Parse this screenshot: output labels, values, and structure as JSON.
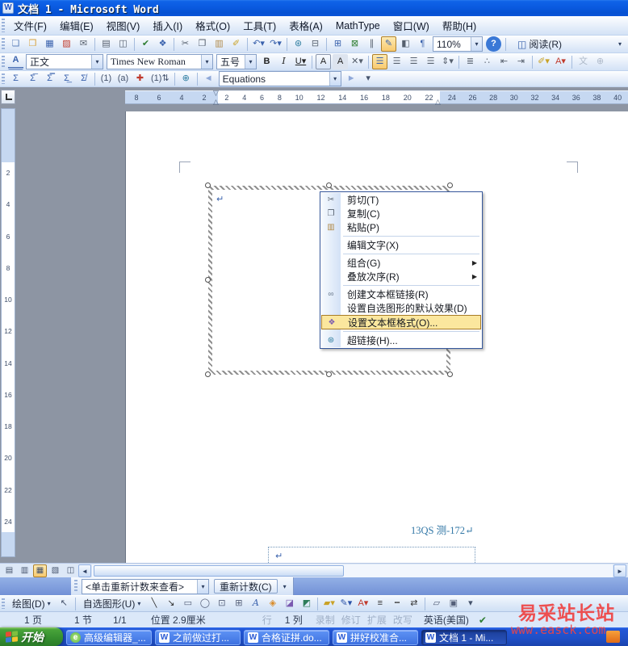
{
  "title_bar": {
    "title": "文档 1 - Microsoft Word",
    "app_icon_glyph": "W"
  },
  "menu_bar": [
    "文件(F)",
    "编辑(E)",
    "视图(V)",
    "插入(I)",
    "格式(O)",
    "工具(T)",
    "表格(A)",
    "MathType",
    "窗口(W)",
    "帮助(H)"
  ],
  "standard_toolbar": {
    "icons": [
      {
        "g": "❏",
        "n": "new-document-icon",
        "c": "#5b7fb9"
      },
      {
        "g": "❒",
        "n": "open-icon",
        "c": "#d8a23c"
      },
      {
        "g": "▦",
        "n": "save-icon",
        "c": "#3a62ad"
      },
      {
        "g": "▨",
        "n": "permission-icon",
        "c": "#c0392b"
      },
      {
        "g": "✉",
        "n": "email-icon",
        "c": "#56606e"
      },
      {
        "type": "s"
      },
      {
        "g": "▤",
        "n": "print-icon",
        "c": "#56606e"
      },
      {
        "g": "◫",
        "n": "print-preview-icon",
        "c": "#56606e"
      },
      {
        "type": "s"
      },
      {
        "g": "✔",
        "n": "spelling-icon",
        "c": "#2e7d32"
      },
      {
        "g": "❖",
        "n": "research-icon",
        "c": "#3a62ad"
      },
      {
        "type": "s"
      },
      {
        "g": "✂",
        "n": "cut-toolbar-icon",
        "c": "#56606e"
      },
      {
        "g": "❐",
        "n": "copy-toolbar-icon",
        "c": "#56606e"
      },
      {
        "g": "▥",
        "n": "paste-toolbar-icon",
        "c": "#b08a4a"
      },
      {
        "g": "✐",
        "n": "format-painter-icon",
        "c": "#c9a227"
      },
      {
        "type": "s"
      },
      {
        "g": "↶▾",
        "n": "undo-button",
        "c": "#3a62ad",
        "cls": "wide"
      },
      {
        "g": "↷▾",
        "n": "redo-button",
        "c": "#3a62ad",
        "cls": "wide"
      },
      {
        "type": "s"
      },
      {
        "g": "⊛",
        "n": "insert-hyperlink-icon",
        "c": "#2e7da0"
      },
      {
        "g": "⊟",
        "n": "tables-borders-icon",
        "c": "#56606e"
      },
      {
        "type": "s"
      },
      {
        "g": "⊞",
        "n": "insert-table-icon",
        "c": "#3a62ad"
      },
      {
        "g": "⊠",
        "n": "insert-excel-icon",
        "c": "#2e7d32"
      },
      {
        "g": "∥",
        "n": "columns-icon",
        "c": "#56606e"
      },
      {
        "g": "✎",
        "n": "drawing-toggle-icon",
        "c": "#3a62ad",
        "cls": "hl"
      },
      {
        "g": "◧",
        "n": "document-map-icon",
        "c": "#56606e"
      },
      {
        "g": "¶",
        "n": "show-hide-marks-icon",
        "c": "#3a62ad"
      }
    ],
    "zoom_value": "110%",
    "help_glyph": "?",
    "read_icon": "◫",
    "read_label": "阅读(R)",
    "overflow_glyph": "▾"
  },
  "formatting_toolbar": {
    "pane_icon": [
      {
        "g": "A",
        "n": "styles-pane-icon",
        "c": "#3a62ad",
        "cls": "stylespane"
      }
    ],
    "style_value": "正文",
    "font_value": "Times New Roman",
    "size_value": "五号",
    "icons": [
      {
        "g": "B",
        "n": "bold-button",
        "c": "#222222",
        "cls": "b"
      },
      {
        "g": "I",
        "n": "italic-button",
        "c": "#222222",
        "cls": "i"
      },
      {
        "g": "U▾",
        "n": "underline-button",
        "c": "#222222",
        "cls": "u wide"
      },
      {
        "type": "s"
      },
      {
        "g": "A",
        "n": "char-border-icon",
        "c": "#222222",
        "cls": "boxed"
      },
      {
        "g": "A",
        "n": "char-shading-icon",
        "c": "#222222",
        "cls": "shaded"
      },
      {
        "g": "✕▾",
        "n": "char-scale-icon",
        "c": "#56606e",
        "cls": "wide"
      },
      {
        "type": "s"
      },
      {
        "g": "☰",
        "n": "align-justify-button",
        "c": "#3a62ad",
        "cls": "hl"
      },
      {
        "g": "☰",
        "n": "align-center-button",
        "c": "#56606e"
      },
      {
        "g": "☰",
        "n": "align-right-button",
        "c": "#56606e"
      },
      {
        "g": "☰",
        "n": "align-distribute-button",
        "c": "#56606e"
      },
      {
        "g": "⇕▾",
        "n": "line-spacing-button",
        "c": "#56606e",
        "cls": "wide"
      },
      {
        "type": "s"
      },
      {
        "g": "≣",
        "n": "numbering-icon",
        "c": "#56606e"
      },
      {
        "g": "∴",
        "n": "bullets-icon",
        "c": "#56606e"
      },
      {
        "g": "⇤",
        "n": "decrease-indent-icon",
        "c": "#56606e"
      },
      {
        "g": "⇥",
        "n": "increase-indent-icon",
        "c": "#56606e"
      },
      {
        "type": "s"
      },
      {
        "g": "✐▾",
        "n": "highlight-color-button",
        "c": "#c9a227",
        "cls": "wide"
      },
      {
        "g": "A▾",
        "n": "font-color-button",
        "c": "#c0392b",
        "cls": "wide"
      },
      {
        "type": "s"
      },
      {
        "g": "文",
        "n": "pinyin-guide-icon",
        "cls": "grayed"
      },
      {
        "g": "⊕",
        "n": "enclose-characters-icon",
        "cls": "grayed"
      }
    ]
  },
  "math_toolbar": {
    "icons": [
      {
        "g": "Σ",
        "n": "mt-inline-equation-icon",
        "c": "#3a62ad"
      },
      {
        "g": "Σ̅",
        "n": "mt-display-equation-icon",
        "c": "#3a62ad"
      },
      {
        "g": "Σ̿",
        "n": "mt-right-numbered-equation-icon",
        "c": "#3a62ad"
      },
      {
        "g": "Σ̲",
        "n": "mt-left-numbered-equation-icon",
        "c": "#3a62ad"
      },
      {
        "g": "Σ̸",
        "n": "mt-convert-equations-icon",
        "c": "#3a62ad"
      },
      {
        "type": "s"
      },
      {
        "g": "(1)",
        "n": "mt-insert-number-icon",
        "c": "#44526b",
        "cls": "wide"
      },
      {
        "g": "(a)",
        "n": "mt-insert-reference-icon",
        "c": "#44526b",
        "cls": "wide"
      },
      {
        "g": "✚",
        "n": "mt-chapter-break-icon",
        "c": "#c0392b"
      },
      {
        "g": "(1)⇅",
        "n": "mt-update-numbers-icon",
        "c": "#44526b",
        "cls": "wide"
      },
      {
        "type": "s"
      },
      {
        "g": "⊕",
        "n": "mt-export-web-icon",
        "c": "#2e7da0"
      },
      {
        "type": "s"
      },
      {
        "g": "◄",
        "n": "mt-prev-equation-icon",
        "c": "#8fa8d8"
      }
    ],
    "combo_value": "Equations",
    "icons_after": [
      {
        "g": "►",
        "n": "mt-next-equation-icon",
        "c": "#8fa8d8"
      },
      {
        "g": "▾",
        "n": "toolbar-options-icon",
        "c": "#44526b"
      }
    ]
  },
  "ruler": {
    "left_numbers": [
      "8",
      "6",
      "4",
      "2"
    ],
    "center_numbers": [
      "2",
      "4",
      "6",
      "8",
      "10",
      "12",
      "14",
      "16",
      "18",
      "20",
      "22"
    ],
    "right_numbers": [
      "24",
      "26",
      "28",
      "30",
      "32",
      "34",
      "36",
      "38",
      "40"
    ],
    "first_line_indent_glyph": "▽",
    "hanging_indent_glyph": "△",
    "right_indent_glyph": "△"
  },
  "vruler_numbers": [
    "2",
    "4",
    "6",
    "8",
    "10",
    "12",
    "14",
    "16",
    "18",
    "20",
    "22",
    "24"
  ],
  "document": {
    "para_mark": "↵",
    "doc_number": "13QS 测-172"
  },
  "context_menu": {
    "items": [
      {
        "icon": "✂",
        "label": "剪切(T)"
      },
      {
        "icon": "❐",
        "label": "复制(C)"
      },
      {
        "icon": "▥",
        "label": "粘贴(P)"
      },
      {
        "label": "编辑文字(X)"
      },
      {
        "label": "组合(G)",
        "arrow": "▶"
      },
      {
        "label": "叠放次序(R)",
        "arrow": "▶"
      },
      {
        "icon": "∞",
        "label": "创建文本框链接(R)"
      },
      {
        "label": "设置自选图形的默认效果(D)"
      },
      {
        "icon": "❖",
        "label": "设置文本框格式(O)..."
      },
      {
        "icon": "⊛",
        "label": "超链接(H)..."
      }
    ]
  },
  "scroll_area": {
    "view_buttons": [
      {
        "g": "▤",
        "n": "view-normal-button",
        "c": "#44526b"
      },
      {
        "g": "▥",
        "n": "view-web-layout-button",
        "c": "#44526b"
      },
      {
        "g": "▦",
        "n": "view-print-layout-button",
        "c": "#44526b",
        "cls": "hl"
      },
      {
        "g": "▧",
        "n": "view-outline-button",
        "c": "#44526b"
      },
      {
        "g": "◫",
        "n": "view-reading-button",
        "c": "#44526b"
      }
    ],
    "left_arrow": "◄",
    "right_arrow": "►"
  },
  "wordcount_toolbar": {
    "combo_value": "<单击重新计数来查看>",
    "recount_label": "重新计数(C)",
    "overflow_glyph": "▾"
  },
  "drawing_toolbar": {
    "draw_label": "绘图(D)",
    "autoshapes_label": "自选图形(U)",
    "arrow_glyph": "▾",
    "select_icon": [
      {
        "g": "↖",
        "n": "select-objects-icon",
        "c": "#44526b"
      }
    ],
    "icons": [
      {
        "g": "╲",
        "n": "draw-line-icon",
        "c": "#333333"
      },
      {
        "g": "↘",
        "n": "draw-arrow-icon",
        "c": "#333333"
      },
      {
        "g": "▭",
        "n": "rectangle-icon",
        "c": "#55607a"
      },
      {
        "g": "◯",
        "n": "oval-icon",
        "c": "#55607a"
      },
      {
        "g": "⊡",
        "n": "text-box-icon",
        "c": "#55607a"
      },
      {
        "g": "⊞",
        "n": "vertical-text-box-icon",
        "c": "#55607a"
      },
      {
        "g": "A",
        "n": "wordart-icon",
        "c": "#3a62ad",
        "cls": "i"
      },
      {
        "g": "◈",
        "n": "diagram-icon",
        "c": "#d98c2b"
      },
      {
        "g": "◪",
        "n": "clip-art-icon",
        "c": "#7a5ab0"
      },
      {
        "g": "◩",
        "n": "insert-picture-icon",
        "c": "#2e7d5a"
      },
      {
        "type": "s"
      },
      {
        "g": "▰▾",
        "n": "fill-color-button",
        "c": "#c9a227",
        "cls": "wide"
      },
      {
        "g": "✎▾",
        "n": "line-color-button",
        "c": "#2a52a8",
        "cls": "wide"
      },
      {
        "g": "A▾",
        "n": "draw-font-color-button",
        "c": "#c0392b",
        "cls": "wide"
      },
      {
        "g": "≡",
        "n": "line-style-icon",
        "c": "#333333"
      },
      {
        "g": "┅",
        "n": "dash-style-icon",
        "c": "#333333"
      },
      {
        "g": "⇄",
        "n": "arrow-style-icon",
        "c": "#333333"
      },
      {
        "type": "s"
      },
      {
        "g": "▱",
        "n": "shadow-style-icon",
        "c": "#55607a"
      },
      {
        "g": "▣",
        "n": "threed-style-icon",
        "c": "#55607a"
      },
      {
        "g": "▾",
        "n": "toolbar-options-icon",
        "c": "#44526b"
      }
    ]
  },
  "status_bar": {
    "items": [
      {
        "t": "1 页",
        "n": "status-page",
        "cls": "m30"
      },
      {
        "t": "1 节",
        "n": "status-section",
        "cls": "m40"
      },
      {
        "t": "1/1",
        "n": "status-page-of-total",
        "cls": "m26"
      },
      {
        "t": "位置 2.9厘米",
        "n": "status-position",
        "cls": "m30"
      },
      {
        "t": "行",
        "n": "status-line",
        "cls": "m70 gray"
      },
      {
        "t": "1 列",
        "n": "status-column",
        "cls": "m16"
      },
      {
        "t": "录制",
        "n": "status-record-mode",
        "cls": "m16 gray"
      },
      {
        "t": "修订",
        "n": "status-track-changes",
        "cls": "m8 gray"
      },
      {
        "t": "扩展",
        "n": "status-extend-mode",
        "cls": "m8 gray"
      },
      {
        "t": "改写",
        "n": "status-overtype-mode",
        "cls": "m8 gray"
      },
      {
        "t": "英语(美国)",
        "n": "status-language",
        "cls": "m14"
      },
      {
        "t": "✔",
        "n": "spelling-status-icon",
        "c": "#2e7d32",
        "cls": "m12"
      }
    ]
  },
  "taskbar": {
    "start_label": "开始",
    "tasks": [
      {
        "ic": "e",
        "label": "高级编辑器_...",
        "cls": "ie"
      },
      {
        "ic": "W",
        "label": "之前做过打..."
      },
      {
        "ic": "W",
        "label": "合格证拼.do..."
      },
      {
        "ic": "W",
        "label": "拼好校准合..."
      },
      {
        "ic": "W",
        "label": "文档 1 - Mi...",
        "cls": "active"
      }
    ]
  },
  "watermark": {
    "line1": "易采站长站",
    "line2": "www.easck.com"
  },
  "colors": {
    "titlebar_blue": "#0a5ae0",
    "highlight_orange": "#fbe79e",
    "highlight_border": "#a87c28",
    "taskbar_blue": "#1f4fc6",
    "start_green": "#369030",
    "watermark_red": "#ef4444",
    "doc_background": "#8d95a3",
    "doc_number_blue": "#3277a6"
  }
}
